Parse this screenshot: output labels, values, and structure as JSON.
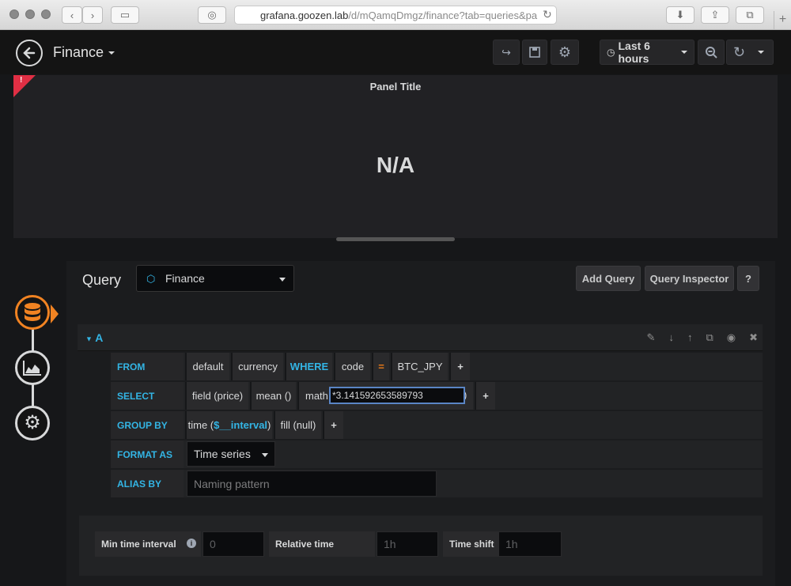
{
  "browser": {
    "url_host": "grafana.goozen.lab",
    "url_path": "/d/mQamqDmgz/finance?tab=queries&pa"
  },
  "navbar": {
    "dashboard_title": "Finance",
    "time_range": "Last 6 hours"
  },
  "panel": {
    "title": "Panel Title",
    "value": "N/A",
    "error_mark": "!"
  },
  "query_editor": {
    "label": "Query",
    "datasource": "Finance",
    "add_query_label": "Add Query",
    "query_inspector_label": "Query Inspector",
    "help_label": "?"
  },
  "query": {
    "ref_id": "A",
    "from": {
      "key": "FROM",
      "policy": "default",
      "measurement": "currency",
      "where_kw": "WHERE",
      "tag": "code",
      "operator": "=",
      "value": "BTC_JPY",
      "add": "+"
    },
    "select": {
      "key": "SELECT",
      "field": "field (price)",
      "mean": "mean ()",
      "math_prefix": "math",
      "math_value": "*3.141592653589793",
      "math_suffix": ")",
      "add": "+"
    },
    "group_by": {
      "key": "GROUP BY",
      "time_prefix": "time (",
      "time_var": "$__interval",
      "time_suffix": ")",
      "fill": "fill (null)",
      "add": "+"
    },
    "format_as": {
      "key": "FORMAT AS",
      "value": "Time series"
    },
    "alias_by": {
      "key": "ALIAS BY",
      "placeholder": "Naming pattern"
    }
  },
  "options": {
    "min_interval_label": "Min time interval",
    "min_interval_placeholder": "0",
    "relative_time_label": "Relative time",
    "relative_time_placeholder": "1h",
    "time_shift_label": "Time shift",
    "time_shift_placeholder": "1h"
  }
}
